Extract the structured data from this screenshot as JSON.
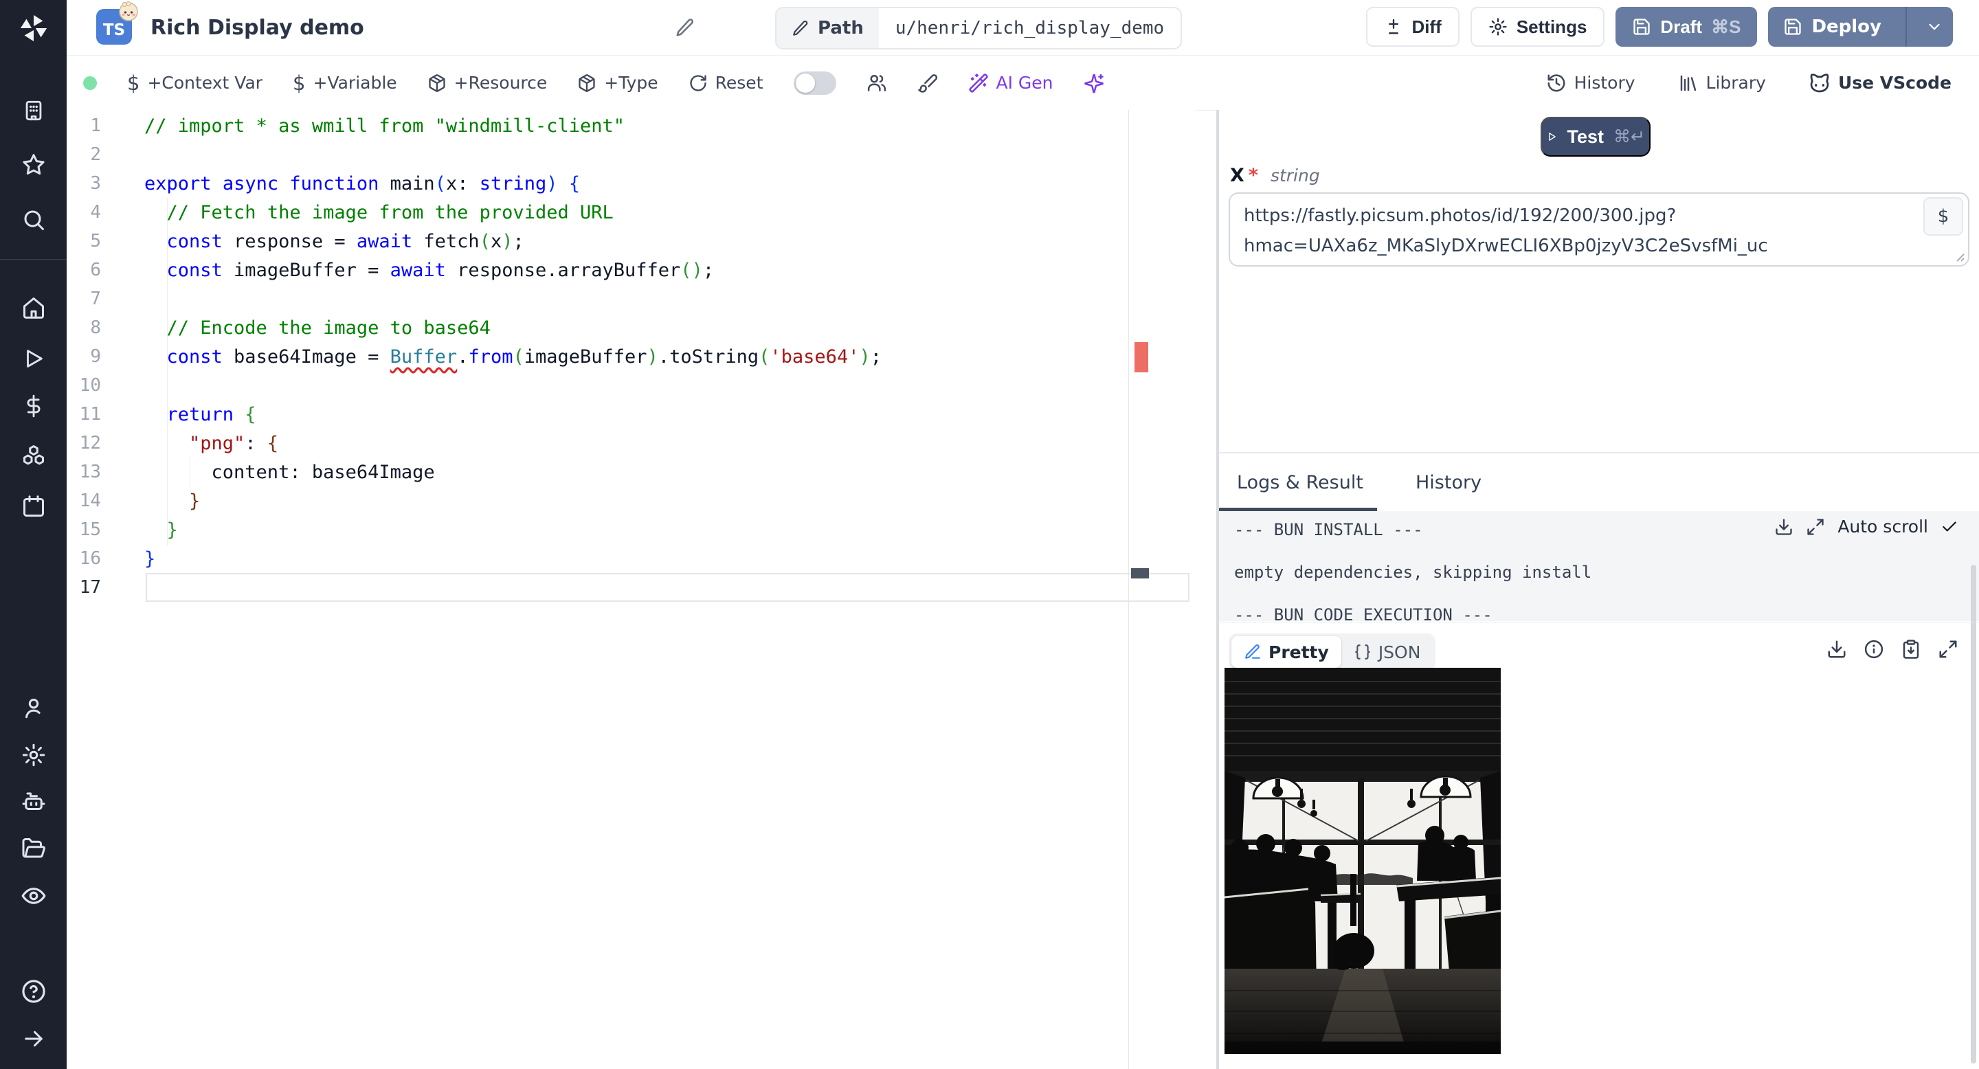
{
  "sidebar": {
    "icons": [
      "windmill-logo",
      "workspace-building",
      "favorites-star",
      "search",
      "home",
      "runs-play",
      "variables-dollar",
      "resources-boxes",
      "schedules-calendar",
      "user",
      "settings-gear",
      "workers-robot",
      "folders",
      "audit-eye",
      "help",
      "collapse-arrow-right"
    ]
  },
  "header": {
    "language_badge": "TS",
    "title": "Rich Display demo",
    "path_label": "Path",
    "path_value": "u/henri/rich_display_demo",
    "diff_label": "Diff",
    "settings_label": "Settings",
    "draft_label": "Draft",
    "draft_shortcut": "⌘S",
    "deploy_label": "Deploy"
  },
  "toolbar": {
    "context_var": "+Context Var",
    "variable": "+Variable",
    "resource": "+Resource",
    "type": "+Type",
    "reset": "Reset",
    "ai_gen": "AI Gen",
    "history": "History",
    "library": "Library",
    "vscode": "Use VScode",
    "dollar_glyph": "$"
  },
  "editor": {
    "language": "typescript",
    "lines": [
      {
        "n": 1,
        "toks": [
          [
            "// import * as wmill from \"windmill-client\"",
            "c"
          ]
        ]
      },
      {
        "n": 2,
        "toks": []
      },
      {
        "n": 3,
        "toks": [
          [
            "export",
            "k"
          ],
          [
            " ",
            "d"
          ],
          [
            "async",
            "k"
          ],
          [
            " ",
            "d"
          ],
          [
            "function",
            "k"
          ],
          [
            " main",
            "d"
          ],
          [
            "(",
            "b1"
          ],
          [
            "x",
            "d"
          ],
          [
            ": ",
            "d"
          ],
          [
            "string",
            "k"
          ],
          [
            ")",
            "b1"
          ],
          [
            " ",
            "d"
          ],
          [
            "{",
            "b1"
          ]
        ]
      },
      {
        "n": 4,
        "toks": [
          [
            "  ",
            "d"
          ],
          [
            "// Fetch the image from the provided URL",
            "c"
          ]
        ]
      },
      {
        "n": 5,
        "toks": [
          [
            "  ",
            "d"
          ],
          [
            "const",
            "k"
          ],
          [
            " response = ",
            "d"
          ],
          [
            "await",
            "k"
          ],
          [
            " fetch",
            "d"
          ],
          [
            "(",
            "b2"
          ],
          [
            "x",
            "d"
          ],
          [
            ")",
            "b2"
          ],
          [
            ";",
            "d"
          ]
        ]
      },
      {
        "n": 6,
        "toks": [
          [
            "  ",
            "d"
          ],
          [
            "const",
            "k"
          ],
          [
            " imageBuffer = ",
            "d"
          ],
          [
            "await",
            "k"
          ],
          [
            " response.arrayBuffer",
            "d"
          ],
          [
            "(",
            "b2"
          ],
          [
            ")",
            "b2"
          ],
          [
            ";",
            "d"
          ]
        ]
      },
      {
        "n": 7,
        "toks": []
      },
      {
        "n": 8,
        "toks": [
          [
            "  ",
            "d"
          ],
          [
            "// Encode the image to base64",
            "c"
          ]
        ]
      },
      {
        "n": 9,
        "toks": [
          [
            "  ",
            "d"
          ],
          [
            "const",
            "k"
          ],
          [
            " base64Image = ",
            "d"
          ],
          [
            "Buffer",
            "err"
          ],
          [
            ".",
            "d"
          ],
          [
            "from",
            "k"
          ],
          [
            "(",
            "b2"
          ],
          [
            "imageBuffer",
            "d"
          ],
          [
            ")",
            "b2"
          ],
          [
            ".toString",
            "d"
          ],
          [
            "(",
            "b2"
          ],
          [
            "'base64'",
            "s"
          ],
          [
            ")",
            "b2"
          ],
          [
            ";",
            "d"
          ]
        ]
      },
      {
        "n": 10,
        "toks": []
      },
      {
        "n": 11,
        "toks": [
          [
            "  ",
            "d"
          ],
          [
            "return",
            "k"
          ],
          [
            " ",
            "d"
          ],
          [
            "{",
            "b2"
          ]
        ]
      },
      {
        "n": 12,
        "toks": [
          [
            "    ",
            "d"
          ],
          [
            "\"png\"",
            "s"
          ],
          [
            ": ",
            "d"
          ],
          [
            "{",
            "b3"
          ]
        ]
      },
      {
        "n": 13,
        "toks": [
          [
            "      content: base64Image",
            "d"
          ]
        ]
      },
      {
        "n": 14,
        "toks": [
          [
            "    ",
            "d"
          ],
          [
            "}",
            "b3"
          ]
        ]
      },
      {
        "n": 15,
        "toks": [
          [
            "  ",
            "d"
          ],
          [
            "}",
            "b2"
          ]
        ]
      },
      {
        "n": 16,
        "toks": [
          [
            "}",
            "b1"
          ]
        ]
      },
      {
        "n": 17,
        "toks": [],
        "current": true
      }
    ]
  },
  "run": {
    "test_label": "Test",
    "test_shortcut": "⌘↵"
  },
  "schema_form": {
    "arg_name": "X",
    "required_mark": "*",
    "arg_type": "string",
    "arg_value": "https://fastly.picsum.photos/id/192/200/300.jpg?hmac=UAXa6z_MKaSlyDXrwECLI6XBp0jzyV3C2eSvsfMi_uc",
    "insert_var_label": "$"
  },
  "output": {
    "tab_logs": "Logs & Result",
    "tab_history": "History",
    "auto_scroll_label": "Auto scroll",
    "log_lines": [
      "--- BUN INSTALL ---",
      "",
      "empty dependencies, skipping install",
      "",
      "--- BUN CODE EXECUTION ---"
    ],
    "view_pretty": "Pretty",
    "view_json": "JSON"
  },
  "colors": {
    "accent_slate": "#687ca2",
    "accent_dark": "#3e4c6d",
    "ai_purple": "#7c3aed",
    "success_green": "#7ee2a8",
    "error_red": "#ed6f63",
    "keyword_blue": "#0000ff",
    "comment_green": "#008000",
    "string_red": "#a31515"
  }
}
